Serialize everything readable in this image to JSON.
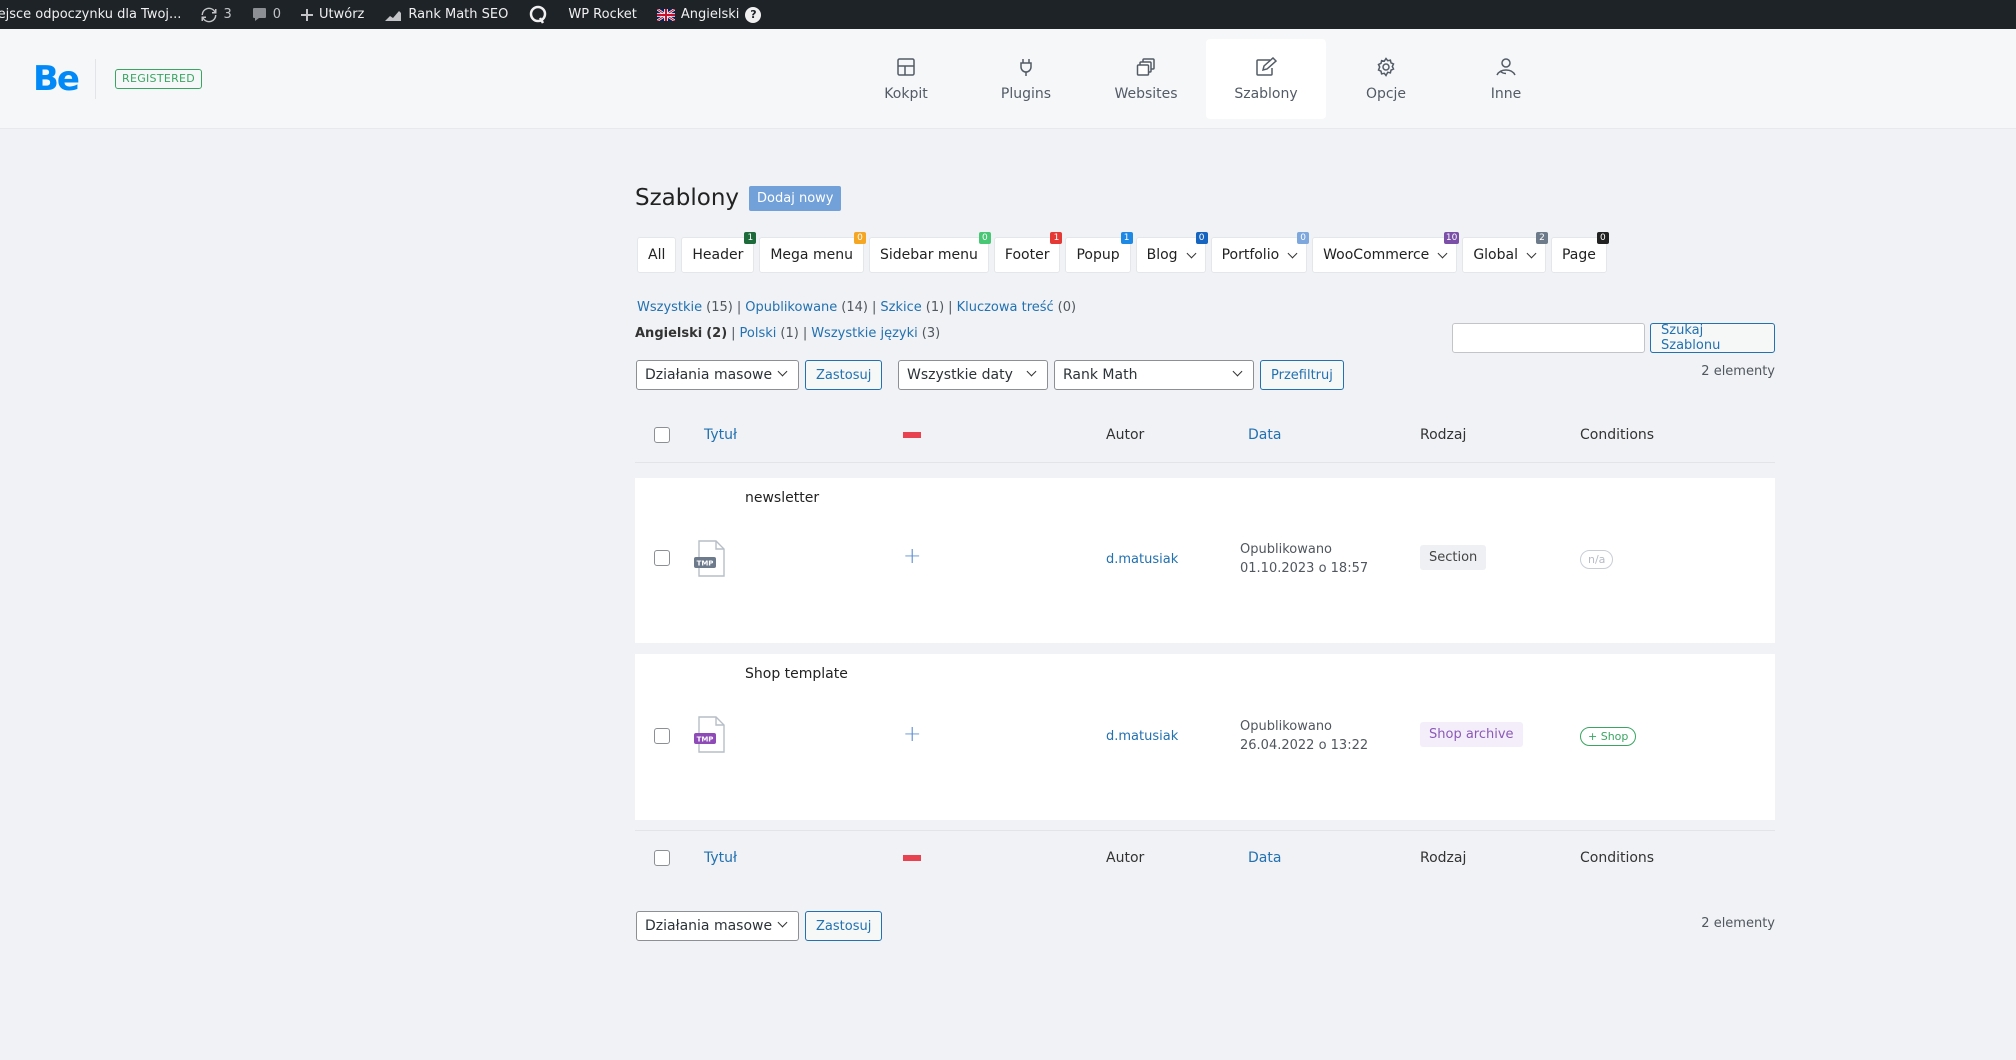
{
  "admin_bar": {
    "site_name": "iejsce odpoczynku dla Twoj...",
    "updates_count": "3",
    "comments_count": "0",
    "new_label": "Utwórz",
    "rank_math_label": "Rank Math SEO",
    "wp_rocket_label": "WP Rocket",
    "language_label": "Angielski",
    "help_label": "?"
  },
  "header": {
    "logo": "Be",
    "registered_badge": "REGISTERED",
    "nav": [
      {
        "label": "Kokpit",
        "icon": "dashboard-icon"
      },
      {
        "label": "Plugins",
        "icon": "plug-icon"
      },
      {
        "label": "Websites",
        "icon": "websites-icon"
      },
      {
        "label": "Szablony",
        "icon": "templates-icon",
        "active": true
      },
      {
        "label": "Opcje",
        "icon": "gear-icon"
      },
      {
        "label": "Inne",
        "icon": "person-icon"
      }
    ]
  },
  "page": {
    "title": "Szablony",
    "add_new": "Dodaj nowy"
  },
  "type_tabs": [
    {
      "label": "All",
      "badge": null
    },
    {
      "label": "Header",
      "badge": "1",
      "badge_color": "#1d6b3a"
    },
    {
      "label": "Mega menu",
      "badge": "0",
      "badge_color": "#f5a623"
    },
    {
      "label": "Sidebar menu",
      "badge": "0",
      "badge_color": "#48c774"
    },
    {
      "label": "Footer",
      "badge": "1",
      "badge_color": "#e53935"
    },
    {
      "label": "Popup",
      "badge": "1",
      "badge_color": "#1e88e5"
    },
    {
      "label": "Blog",
      "badge": "0",
      "badge_color": "#1565c0",
      "dropdown": true
    },
    {
      "label": "Portfolio",
      "badge": "0",
      "badge_color": "#7da7dd",
      "dropdown": true
    },
    {
      "label": "WooCommerce",
      "badge": "10",
      "badge_color": "#7b4fa7",
      "dropdown": true
    },
    {
      "label": "Global",
      "badge": "2",
      "badge_color": "#6c7a89",
      "dropdown": true
    },
    {
      "label": "Page",
      "badge": "0",
      "badge_color": "#222222"
    }
  ],
  "status_links": [
    {
      "label": "Wszystkie",
      "count": "(15)"
    },
    {
      "label": "Opublikowane",
      "count": "(14)"
    },
    {
      "label": "Szkice",
      "count": "(1)"
    },
    {
      "label": "Kluczowa treść",
      "count": "(0)"
    }
  ],
  "lang_links": [
    {
      "label": "Angielski",
      "count": "(2)",
      "current": true
    },
    {
      "label": "Polski",
      "count": "(1)"
    },
    {
      "label": "Wszystkie języki",
      "count": "(3)"
    }
  ],
  "search": {
    "button": "Szukaj Szablonu",
    "value": ""
  },
  "filters": {
    "bulk_actions": "Działania masowe",
    "apply": "Zastosuj",
    "dates": "Wszystkie daty",
    "rank_math": "Rank Math",
    "filter": "Przefiltruj",
    "count": "2 elementy"
  },
  "columns": {
    "title": "Tytuł",
    "author": "Autor",
    "date": "Data",
    "type": "Rodzaj",
    "conditions": "Conditions"
  },
  "rows": [
    {
      "title": "newsletter",
      "icon_label": "TMP",
      "icon_color": "#6d7a8c",
      "author": "d.matusiak",
      "status": "Opublikowano",
      "date": "01.10.2023 o 18:57",
      "type": "Section",
      "type_bg": "#eef0f3",
      "type_color": "#444444",
      "condition": "n/a",
      "condition_color": "#b5bcc5"
    },
    {
      "title": "Shop template",
      "icon_label": "TMP",
      "icon_color": "#8e4bb8",
      "author": "d.matusiak",
      "status": "Opublikowano",
      "date": "26.04.2022 o 13:22",
      "type": "Shop archive",
      "type_bg": "#f4eefa",
      "type_color": "#8b5ab6",
      "condition": "+ Shop",
      "condition_color": "#3aa562"
    }
  ]
}
